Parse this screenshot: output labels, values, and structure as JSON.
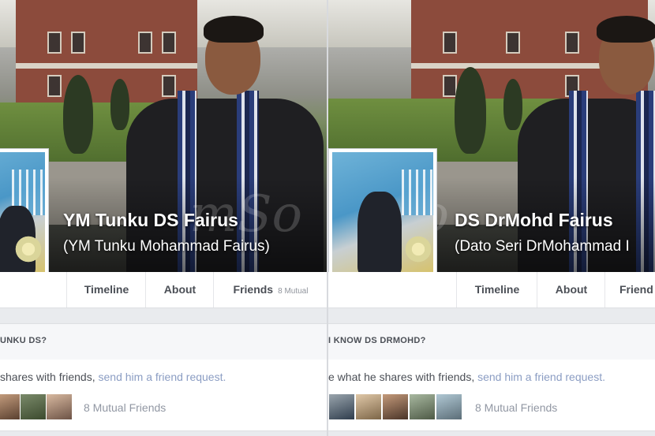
{
  "left": {
    "profile": {
      "name": "YM Tunku DS Fairus",
      "alternate_name": "(YM Tunku Mohammad Fairus)"
    },
    "nav": {
      "timeline": "Timeline",
      "about": "About",
      "friends": "Friends",
      "friends_count": "8 Mutual"
    },
    "know_header": "UNKU DS?",
    "request": {
      "prefix": "shares with friends,",
      "link": "send him a friend request."
    },
    "mutual_friends": "8 Mutual Friends"
  },
  "right": {
    "profile": {
      "name": "DS DrMohd Fairus",
      "alternate_name": "(Dato Seri DrMohammad I"
    },
    "nav": {
      "timeline": "Timeline",
      "about": "About",
      "friends": "Friend"
    },
    "know_header": "I KNOW DS DRMOHD?",
    "request": {
      "prefix": "e what he shares with friends,",
      "link": "send him a friend request."
    },
    "mutual_friends": "8 Mutual Friends"
  },
  "watermark": "mSo",
  "colors": {
    "page_bg": "#e9ebee",
    "link": "#8b9dc3",
    "tab_text": "#4b4f56",
    "muted": "#9197a3"
  }
}
